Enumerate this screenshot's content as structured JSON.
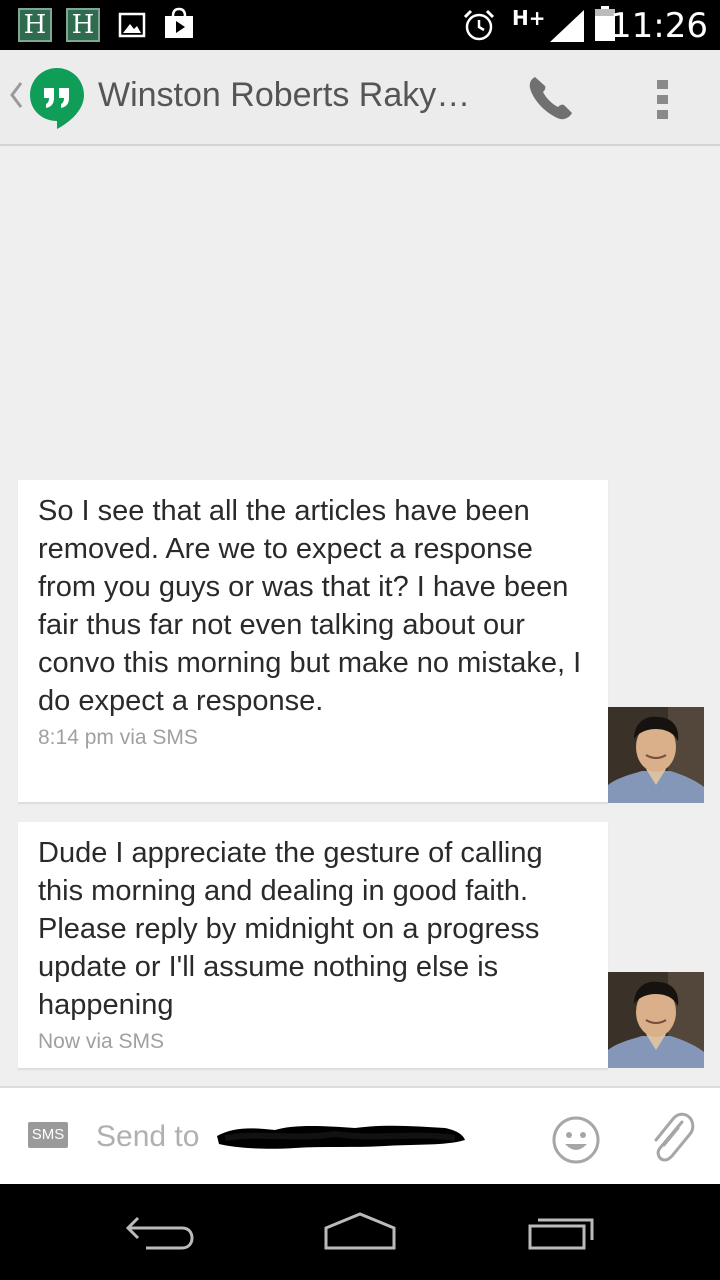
{
  "status_bar": {
    "h_icon_1": "H",
    "h_icon_2": "H",
    "network": "H+",
    "time": "11:26",
    "icons": [
      "h-notification-icon",
      "h-notification-icon",
      "image-icon",
      "shopping-bag-icon",
      "alarm-icon",
      "signal-icon",
      "battery-icon"
    ]
  },
  "header": {
    "contact_name": "Winston Roberts Raky…",
    "icons": [
      "back-chevron-icon",
      "hangouts-logo-icon",
      "phone-icon",
      "overflow-menu-icon"
    ]
  },
  "messages": [
    {
      "text": "So I see that all the articles have been removed. Are we to expect a response from you guys or was that it? I have been fair thus far not even talking about our convo this morning but make no mistake, I do expect a response.",
      "meta": "8:14 pm via SMS"
    },
    {
      "text": "Dude I appreciate the gesture of calling this morning and dealing in good faith. Please reply by midnight on a progress update or I'll assume nothing else is happening",
      "meta": "Now via SMS"
    }
  ],
  "compose": {
    "sms_badge": "SMS",
    "placeholder": "Send to",
    "icons": [
      "emoji-icon",
      "attachment-icon"
    ]
  },
  "colors": {
    "hangouts_green": "#0f9d58",
    "background": "#efefef",
    "status_bar": "#000000",
    "h_icon_bg": "#2f6b4f"
  }
}
